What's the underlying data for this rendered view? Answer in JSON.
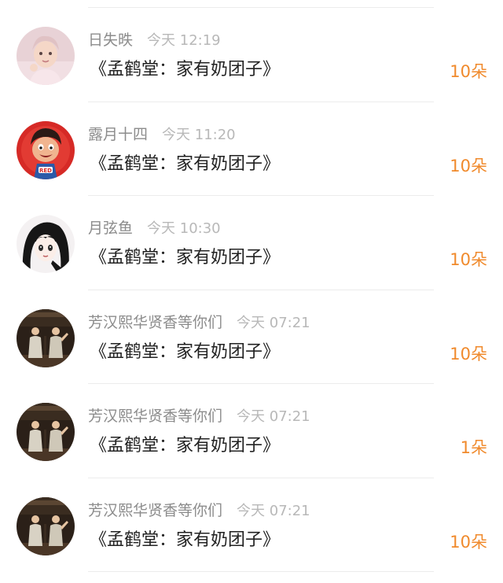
{
  "colors": {
    "accent": "#f08a2c",
    "name": "#8c8c8c",
    "time": "#b8b8b8",
    "title": "#222222",
    "divider": "#ececec"
  },
  "messages": [
    {
      "avatar": "avatar-child-photo",
      "name": "日失昳",
      "time": "今天 12:19",
      "title": "《孟鹤堂：家有奶团子》",
      "count": "10朵"
    },
    {
      "avatar": "avatar-cartoon-red",
      "name": "露月十四",
      "time": "今天 11:20",
      "title": "《孟鹤堂：家有奶团子》",
      "count": "10朵"
    },
    {
      "avatar": "avatar-anime-girl",
      "name": "月弦鱼",
      "time": "今天 10:30",
      "title": "《孟鹤堂：家有奶团子》",
      "count": "10朵"
    },
    {
      "avatar": "avatar-stage-duo",
      "name": "芳汉熙华贤香等你们",
      "time": "今天 07:21",
      "title": "《孟鹤堂：家有奶团子》",
      "count": "10朵"
    },
    {
      "avatar": "avatar-stage-duo",
      "name": "芳汉熙华贤香等你们",
      "time": "今天 07:21",
      "title": "《孟鹤堂：家有奶团子》",
      "count": "1朵"
    },
    {
      "avatar": "avatar-stage-duo",
      "name": "芳汉熙华贤香等你们",
      "time": "今天 07:21",
      "title": "《孟鹤堂：家有奶团子》",
      "count": "10朵"
    }
  ]
}
